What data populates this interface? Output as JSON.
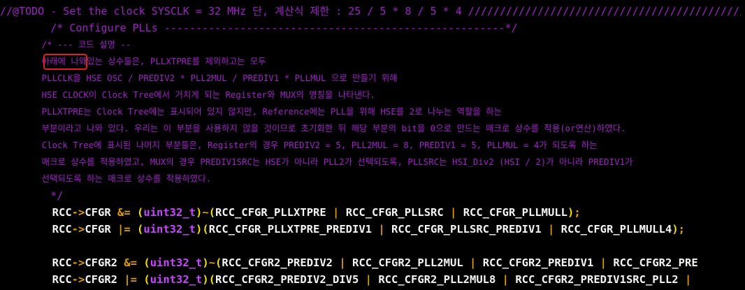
{
  "editor": {
    "comment_lines": [
      "//@TODO - Set the clock SYSCLK = 32 MHz 단, 계산식 제한 : 25 / 5 * 8 / 5 * 4 //////////////////////////////////////////////////////",
      "        /* Configure PLLs ------------------------------------------------------*/",
      "        /* --- 코드 설명 --",
      "        아래에 나와있는 상수들은, PLLXTPRE를 제외하고는 모두",
      "        PLLCLK을 HSE OSC / PREDIV2 * PLL2MUL / PREDIV1 * PLLMUL 으로 만들기 위해",
      "        HSE CLOCK이 Clock Tree에서 거치게 되는 Register와 MUX의 명칭을 나타낸다.",
      "        PLLXTPRE는 Clock Tree에는 표시되어 있지 않지만, Reference에는 PLL을 위해 HSE를 2로 나누는 역할을 하는",
      "        부분이라고 나와 있다. 우리는 이 부분을 사용하지 않을 것이므로 초기화한 뒤 해당 부분의 bit을 0으로 만드는 매크로 상수를 적용(or연산)하였다.",
      "        Clock Tree에 표시된 나머지 부분들은, Register의 경우 PREDIV2 = 5, PLL2MUL = 8, PREDIV1 = 5, PLLMUL = 4가 되도록 하는",
      "        매크로 상수를 적용하였고, MUX의 경우 PREDIV1SRC는 HSE가 아니라 PLL2가 선택되도록, PLLSRC는 HSI_Div2 (HSI / 2)가 아니라 PREDIV1가",
      "        선택되도록 하는 매크로 상수를 적용하였다.",
      "        */"
    ],
    "code_lines": [
      [
        {
          "t": "        RCC",
          "k": "ident"
        },
        {
          "t": "->",
          "k": "op"
        },
        {
          "t": "CFGR ",
          "k": "ident"
        },
        {
          "t": "&=",
          "k": "op"
        },
        {
          "t": " ",
          "k": "ident"
        },
        {
          "t": "(",
          "k": "paren"
        },
        {
          "t": "uint32_t",
          "k": "type"
        },
        {
          "t": ")",
          "k": "paren"
        },
        {
          "t": "~",
          "k": "op"
        },
        {
          "t": "(",
          "k": "paren"
        },
        {
          "t": "RCC_CFGR_PLLXTPRE ",
          "k": "ident"
        },
        {
          "t": "|",
          "k": "op"
        },
        {
          "t": " RCC_CFGR_PLLSRC ",
          "k": "ident"
        },
        {
          "t": "|",
          "k": "op"
        },
        {
          "t": " RCC_CFGR_PLLMULL",
          "k": "ident"
        },
        {
          "t": ")",
          "k": "paren"
        },
        {
          "t": ";",
          "k": "op"
        }
      ],
      [
        {
          "t": "        RCC",
          "k": "ident"
        },
        {
          "t": "->",
          "k": "op"
        },
        {
          "t": "CFGR ",
          "k": "ident"
        },
        {
          "t": "|=",
          "k": "op"
        },
        {
          "t": " ",
          "k": "ident"
        },
        {
          "t": "(",
          "k": "paren"
        },
        {
          "t": "uint32_t",
          "k": "type"
        },
        {
          "t": ")",
          "k": "paren"
        },
        {
          "t": "(",
          "k": "paren"
        },
        {
          "t": "RCC_CFGR_PLLXTPRE_PREDIV1 ",
          "k": "ident"
        },
        {
          "t": "|",
          "k": "op"
        },
        {
          "t": " RCC_CFGR_PLLSRC_PREDIV1 ",
          "k": "ident"
        },
        {
          "t": "|",
          "k": "op"
        },
        {
          "t": " RCC_CFGR_PLLMULL4",
          "k": "ident"
        },
        {
          "t": ")",
          "k": "paren"
        },
        {
          "t": ";",
          "k": "op"
        }
      ],
      [],
      [
        {
          "t": "        RCC",
          "k": "ident"
        },
        {
          "t": "->",
          "k": "op"
        },
        {
          "t": "CFGR2 ",
          "k": "ident"
        },
        {
          "t": "&=",
          "k": "op"
        },
        {
          "t": " ",
          "k": "ident"
        },
        {
          "t": "(",
          "k": "paren"
        },
        {
          "t": "uint32_t",
          "k": "type"
        },
        {
          "t": ")",
          "k": "paren"
        },
        {
          "t": "~",
          "k": "op"
        },
        {
          "t": "(",
          "k": "paren"
        },
        {
          "t": "RCC_CFGR2_PREDIV2 ",
          "k": "ident"
        },
        {
          "t": "|",
          "k": "op"
        },
        {
          "t": " RCC_CFGR2_PLL2MUL ",
          "k": "ident"
        },
        {
          "t": "|",
          "k": "op"
        },
        {
          "t": " RCC_CFGR2_PREDIV1 ",
          "k": "ident"
        },
        {
          "t": "|",
          "k": "op"
        },
        {
          "t": " RCC_CFGR2_PRE",
          "k": "ident"
        }
      ],
      [
        {
          "t": "        RCC",
          "k": "ident"
        },
        {
          "t": "->",
          "k": "op"
        },
        {
          "t": "CFGR2 ",
          "k": "ident"
        },
        {
          "t": "|=",
          "k": "op"
        },
        {
          "t": " ",
          "k": "ident"
        },
        {
          "t": "(",
          "k": "paren"
        },
        {
          "t": "uint32_t",
          "k": "type"
        },
        {
          "t": ")",
          "k": "paren"
        },
        {
          "t": "(",
          "k": "paren"
        },
        {
          "t": "RCC_CFGR2_PREDIV2_DIV5 ",
          "k": "ident"
        },
        {
          "t": "|",
          "k": "op"
        },
        {
          "t": " RCC_CFGR2_PLL2MUL8 ",
          "k": "ident"
        },
        {
          "t": "|",
          "k": "op"
        },
        {
          "t": " RCC_CFGR2_PREDIV1SRC_PLL2 ",
          "k": "ident"
        },
        {
          "t": "|",
          "k": "op"
        }
      ]
    ]
  },
  "annotation": {
    "color": "#e02020",
    "target_text": "아래에"
  },
  "colors": {
    "background": "#000000",
    "comment": "#a020c8",
    "identifier": "#f5f5f5",
    "operator": "#e0a000",
    "paren": "#f0e000",
    "type": "#c846ff"
  }
}
